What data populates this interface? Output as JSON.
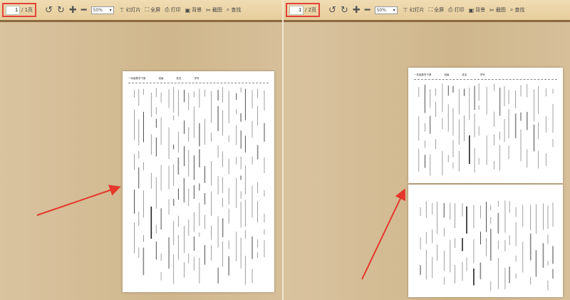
{
  "left": {
    "page_current": "1",
    "page_total": "/ 1页",
    "zoom": "50%"
  },
  "right": {
    "page_current": "1",
    "page_total": "/ 2页",
    "zoom": "50%"
  },
  "toolbar": {
    "buttons": [
      {
        "icon": "slideshow-icon",
        "label": "幻灯片"
      },
      {
        "icon": "fullscreen-icon",
        "label": "全屏"
      },
      {
        "icon": "print-icon",
        "label": "打印"
      },
      {
        "icon": "background-icon",
        "label": "背景"
      },
      {
        "icon": "screenshot-icon",
        "label": "截图"
      },
      {
        "icon": "search-icon",
        "label": "查找"
      }
    ]
  },
  "document": {
    "header": [
      "一年级数学下册",
      "班级",
      "姓名",
      "学号"
    ]
  },
  "colors": {
    "highlight": "#e0443a",
    "arrow": "#e5372c",
    "toolbar_border": "#8a6a3e"
  }
}
